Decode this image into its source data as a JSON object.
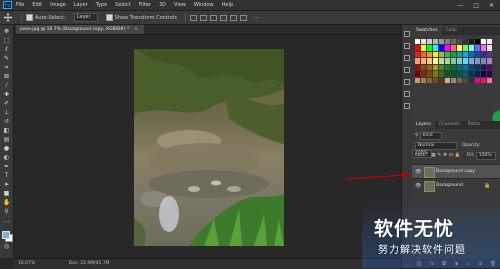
{
  "app": {
    "logo": "Ps"
  },
  "menu": {
    "items": [
      "File",
      "Edit",
      "Image",
      "Layer",
      "Type",
      "Select",
      "Filter",
      "3D",
      "View",
      "Window",
      "Help"
    ]
  },
  "window_controls": {
    "minimize": "—",
    "maximize": "□",
    "close": "✕"
  },
  "options_bar": {
    "auto_select_label": "Auto-Select:",
    "auto_select_value": "Layer",
    "show_transform_label": "Show Transform Controls"
  },
  "document": {
    "tab_title": "pexe.jpg @ 16.7% (Background copy, RGB/8#) *",
    "tab_close": "×"
  },
  "status_bar": {
    "zoom": "16.67%",
    "doc_info": "Doc: 22.9M/45.7M"
  },
  "panels": {
    "swatches_tabs": [
      "Swatches",
      "Color"
    ],
    "layers_tabs": [
      "Layers",
      "Channels",
      "Paths"
    ],
    "kind_label": "Kind",
    "blend_mode": "Normal",
    "opacity_label": "Opacity:",
    "opacity_value": "100%",
    "lock_label": "Lock:",
    "fill_label": "Fill:",
    "fill_value": "100%"
  },
  "layers": [
    {
      "name": "Background copy",
      "selected": true,
      "visible": true
    },
    {
      "name": "Background",
      "selected": false,
      "visible": true,
      "locked": true
    }
  ],
  "watermark": {
    "line1": "软件无忧",
    "line2": "努力解决软件问题"
  },
  "colors": {
    "accent": "#31a8ff",
    "arrow": "#c00000",
    "fg_color": "#78b4e0",
    "bg_color": "#ffffff",
    "green_badge": "#21a24a"
  },
  "swatches": [
    [
      "#ffffff",
      "#e6e6e6",
      "#cccccc",
      "#b3b3b3",
      "#999999",
      "#808080",
      "#666666",
      "#4d4d4d",
      "#333333",
      "#1a1a1a",
      "#000000",
      "#ffffff",
      "#f2f2f2"
    ],
    [
      "#ff0000",
      "#ffff00",
      "#00ff00",
      "#00ffff",
      "#0000ff",
      "#ff00ff",
      "#ff6666",
      "#ffff66",
      "#66ff66",
      "#66ffff",
      "#6666ff",
      "#ff66ff",
      "#e6e6e6"
    ],
    [
      "#ed1c24",
      "#f26522",
      "#f7941d",
      "#fff200",
      "#8dc63f",
      "#39b54a",
      "#00a651",
      "#00a99d",
      "#00aeef",
      "#0072bc",
      "#0054a6",
      "#2e3192",
      "#662d91"
    ],
    [
      "#f69679",
      "#f9ad81",
      "#fdc689",
      "#fff799",
      "#c4df9b",
      "#a3d39c",
      "#82ca9c",
      "#7accc8",
      "#6dcff6",
      "#7da7d9",
      "#8393ca",
      "#8781bd",
      "#a186be"
    ],
    [
      "#9e0b0f",
      "#a0410d",
      "#a36209",
      "#aba000",
      "#598527",
      "#1a7b30",
      "#007236",
      "#00746b",
      "#0076a3",
      "#004a80",
      "#003471",
      "#1b1464",
      "#440e62"
    ],
    [
      "#790000",
      "#7b2e00",
      "#7d4900",
      "#827b00",
      "#406618",
      "#005e20",
      "#005826",
      "#005952",
      "#005b7f",
      "#003663",
      "#002157",
      "#0d004c",
      "#32004b"
    ],
    [
      "#c69c6d",
      "#a67c52",
      "#8c6239",
      "#754c24",
      "#603913",
      "#c7b299",
      "#998675",
      "#736357",
      "#534741",
      "#362f2d",
      "#ec008c",
      "#ed145b",
      "#f06eaa"
    ]
  ],
  "toolbar_icons": [
    "move-icon",
    "marquee-icon",
    "lasso-icon",
    "quick-select-icon",
    "crop-icon",
    "frame-icon",
    "eyedropper-icon",
    "healing-icon",
    "brush-icon",
    "stamp-icon",
    "history-brush-icon",
    "eraser-icon",
    "gradient-icon",
    "blur-icon",
    "dodge-icon",
    "pen-icon",
    "type-icon",
    "path-select-icon",
    "shape-icon",
    "hand-icon",
    "zoom-icon",
    "more-icon"
  ]
}
